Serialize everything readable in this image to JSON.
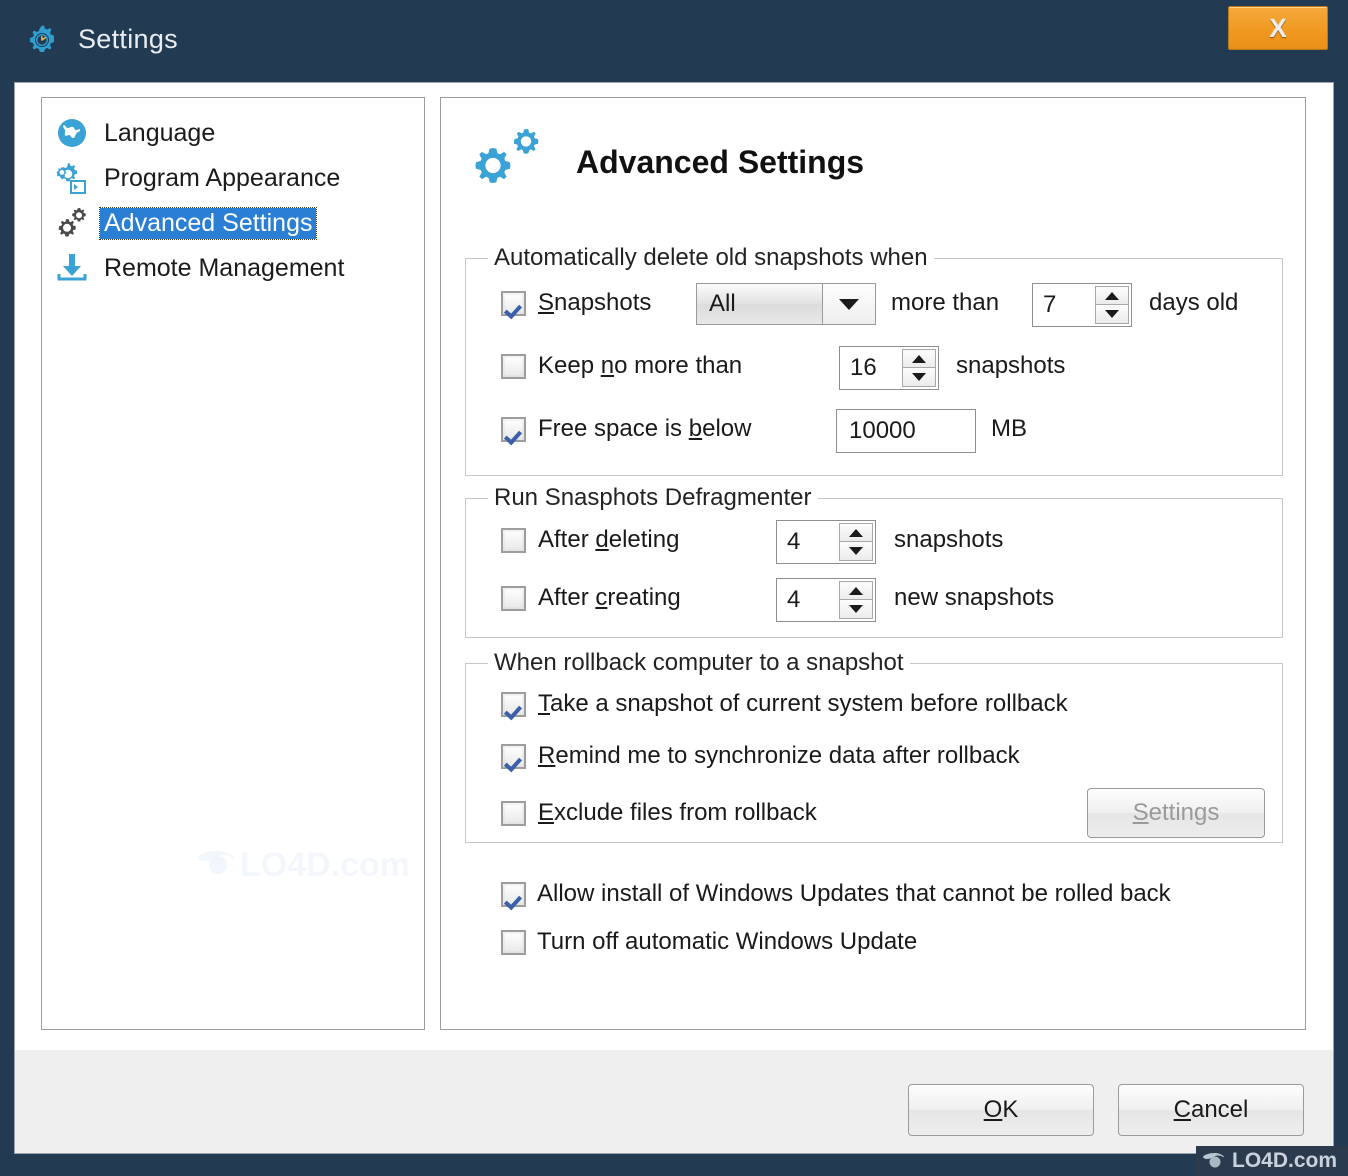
{
  "window": {
    "title": "Settings",
    "title_icon": "gear-clock-icon",
    "close_label": "X",
    "titlebar_color": "#223a52",
    "accent_color": "#2a7fd4",
    "close_button_color": "#f09a22"
  },
  "sidebar": {
    "items": [
      {
        "label": "Language",
        "icon": "globe-icon",
        "selected": false
      },
      {
        "label": "Program Appearance",
        "icon": "gears-window-icon",
        "selected": false
      },
      {
        "label": "Advanced Settings",
        "icon": "gears-icon",
        "selected": true
      },
      {
        "label": "Remote Management",
        "icon": "download-arrow-icon",
        "selected": false
      }
    ]
  },
  "panel": {
    "heading": "Advanced Settings",
    "heading_icon": "gears-icon",
    "groups": [
      {
        "title": "Automatically delete old snapshots when",
        "rows": [
          {
            "checkbox_label": "Snapshots",
            "checkbox_accel": "S",
            "checked": true,
            "combo_value": "All",
            "mid_text": "more than",
            "spin_value": "7",
            "suffix_text": "days old"
          },
          {
            "checkbox_label": "Keep no more than",
            "checkbox_accel": "n",
            "checked": false,
            "spin_value": "16",
            "suffix_text": "snapshots"
          },
          {
            "checkbox_label": "Free space is below",
            "checkbox_accel": "b",
            "checked": true,
            "text_value": "10000",
            "suffix_text": "MB"
          }
        ]
      },
      {
        "title": "Run Snasphots Defragmenter",
        "rows": [
          {
            "checkbox_label": "After deleting",
            "checkbox_accel": "d",
            "checked": false,
            "spin_value": "4",
            "suffix_text": "snapshots"
          },
          {
            "checkbox_label": "After creating",
            "checkbox_accel": "c",
            "checked": false,
            "spin_value": "4",
            "suffix_text": "new snapshots"
          }
        ]
      },
      {
        "title": "When rollback computer to a snapshot",
        "rows": [
          {
            "checkbox_label": "Take a snapshot of current system before rollback",
            "checkbox_accel": "T",
            "checked": true
          },
          {
            "checkbox_label": "Remind me to synchronize data after rollback",
            "checkbox_accel": "R",
            "checked": true
          },
          {
            "checkbox_label": "Exclude files from rollback",
            "checkbox_accel": "E",
            "checked": false,
            "button_label": "Settings",
            "button_accel": "S",
            "button_disabled": true
          }
        ]
      }
    ],
    "loose_checkboxes": [
      {
        "label": "Allow install of Windows Updates that cannot be rolled back",
        "checked": true
      },
      {
        "label": "Turn off automatic Windows Update",
        "checked": false
      }
    ]
  },
  "footer": {
    "ok_label": "OK",
    "ok_accel": "O",
    "cancel_label": "Cancel",
    "cancel_accel": "C"
  },
  "watermarks": {
    "center": "LO4D.com",
    "left": "LO4D.com",
    "badge": "LO4D.com"
  }
}
